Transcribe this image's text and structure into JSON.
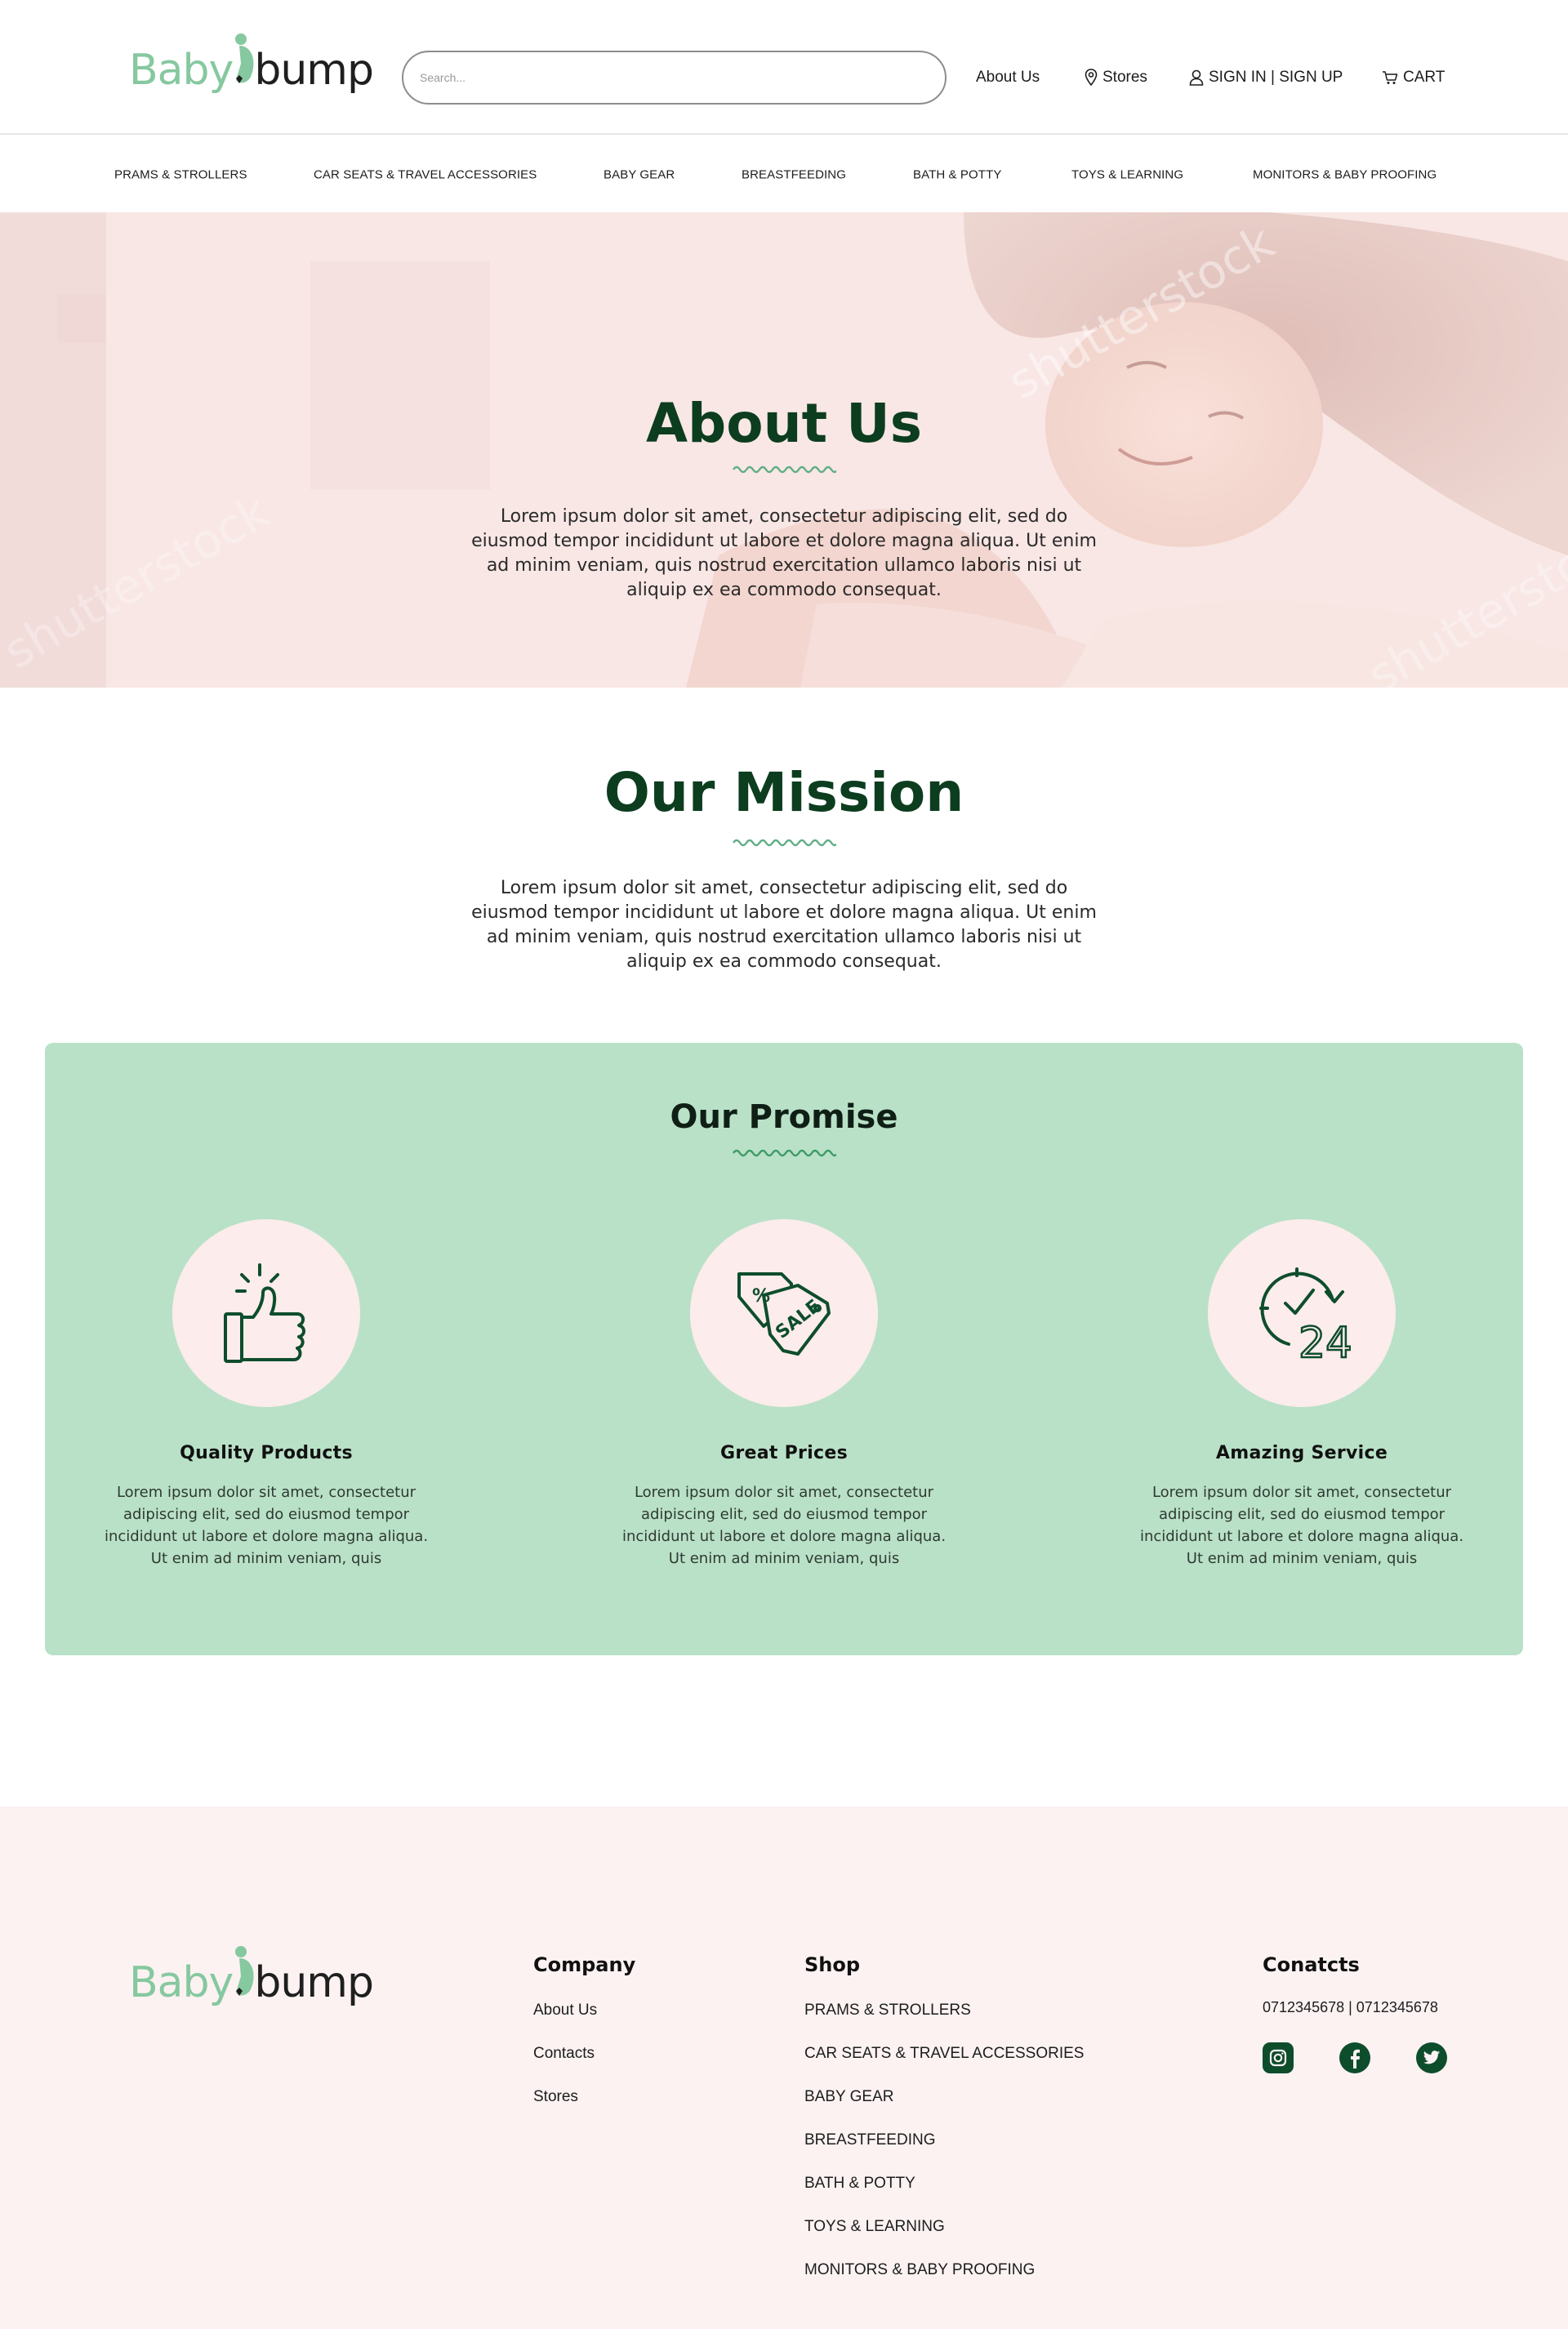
{
  "brand": {
    "logo_baby": "Baby",
    "logo_bump": "bump"
  },
  "search": {
    "placeholder": "Search..."
  },
  "top_nav": {
    "about": "About Us",
    "stores": "Stores",
    "sign": "SIGN IN | SIGN UP",
    "cart": "CART"
  },
  "categories": [
    "PRAMS & STROLLERS",
    "CAR SEATS & TRAVEL ACCESSORIES",
    "BABY GEAR",
    "BREASTFEEDING",
    "BATH & POTTY",
    "TOYS & LEARNING",
    "MONITORS & BABY PROOFING"
  ],
  "hero": {
    "title": "About Us",
    "text": "Lorem ipsum dolor sit amet, consectetur adipiscing elit, sed do eiusmod tempor incididunt ut labore et dolore magna aliqua. Ut enim ad minim veniam, quis nostrud exercitation ullamco laboris nisi ut aliquip ex ea commodo consequat.",
    "watermark": "shutterstock"
  },
  "mission": {
    "title": "Our Mission",
    "text": "Lorem ipsum dolor sit amet, consectetur adipiscing elit, sed do eiusmod tempor incididunt ut labore et dolore magna aliqua. Ut enim ad minim veniam, quis nostrud exercitation ullamco laboris nisi ut aliquip ex ea commodo consequat."
  },
  "promise": {
    "title": "Our Promise",
    "features": [
      {
        "name": "Quality Products",
        "icon": "thumbs-up-icon",
        "text": "Lorem ipsum dolor sit amet, consectetur adipiscing elit, sed do eiusmod tempor incididunt ut labore et dolore magna aliqua. Ut enim ad minim veniam, quis"
      },
      {
        "name": "Great Prices",
        "icon": "sale-tag-icon",
        "badge": "SALE",
        "text": "Lorem ipsum dolor sit amet, consectetur adipiscing elit, sed do eiusmod tempor incididunt ut labore et dolore magna aliqua. Ut enim ad minim veniam, quis"
      },
      {
        "name": "Amazing Service",
        "icon": "clock-24-icon",
        "badge": "24",
        "text": "Lorem ipsum dolor sit amet, consectetur adipiscing elit, sed do eiusmod tempor incididunt ut labore et dolore magna aliqua. Ut enim ad minim veniam, quis"
      }
    ]
  },
  "footer": {
    "company": {
      "heading": "Company",
      "links": [
        "About Us",
        "Contacts",
        "Stores"
      ]
    },
    "shop": {
      "heading": "Shop",
      "links": [
        "PRAMS & STROLLERS",
        "CAR SEATS & TRAVEL ACCESSORIES",
        "BABY GEAR",
        "BREASTFEEDING",
        "BATH & POTTY",
        "TOYS & LEARNING",
        "MONITORS & BABY PROOFING"
      ]
    },
    "contacts": {
      "heading": "Conatcts",
      "phones": "0712345678 |   0712345678",
      "social": [
        "instagram-icon",
        "facebook-icon",
        "twitter-icon"
      ]
    }
  },
  "colors": {
    "brand_green": "#86c89f",
    "dark_green": "#0c3d1f",
    "promise_bg": "#b9e1c7",
    "hero_pink": "#f7e6e4",
    "footer_bg": "#fcf2f2"
  }
}
